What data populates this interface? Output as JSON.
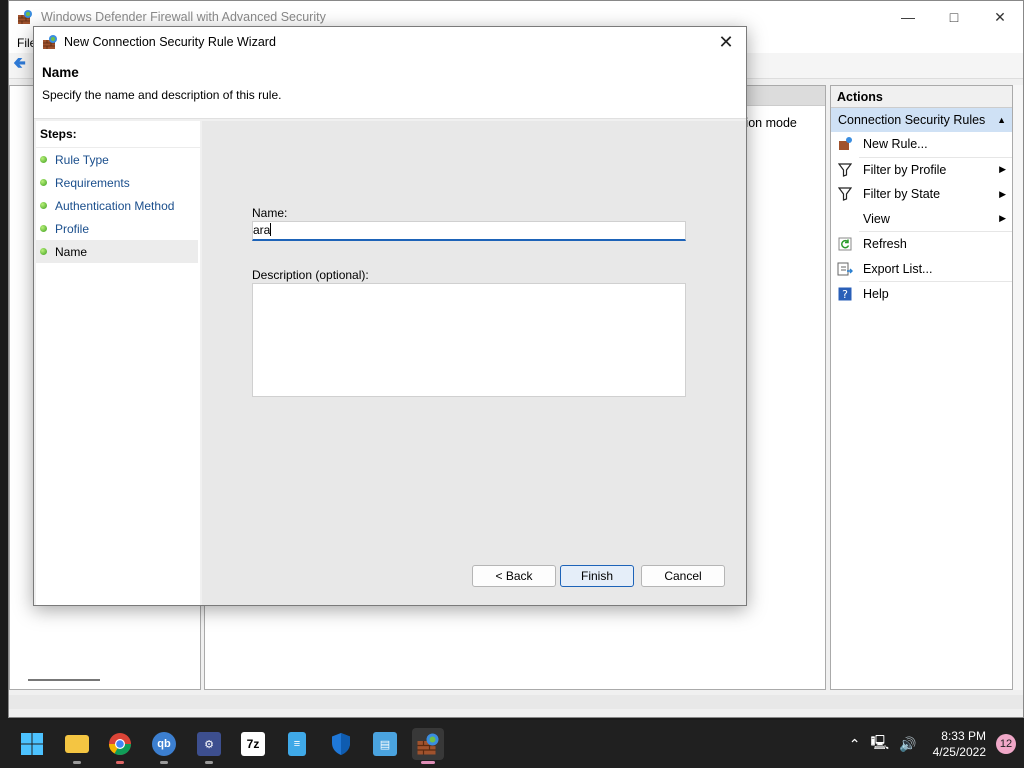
{
  "main_window": {
    "title": "Windows Defender Firewall with Advanced Security",
    "menu_first": "File",
    "center_column_text": "ation mode"
  },
  "actions": {
    "title": "Actions",
    "section": "Connection Security Rules",
    "items": [
      {
        "label": "New Rule...",
        "icon": "new-rule-icon",
        "submenu": false
      },
      {
        "label": "Filter by Profile",
        "icon": "filter-icon",
        "submenu": true
      },
      {
        "label": "Filter by State",
        "icon": "filter-icon",
        "submenu": true
      },
      {
        "label": "View",
        "icon": "",
        "submenu": true
      },
      {
        "label": "Refresh",
        "icon": "refresh-icon",
        "submenu": false
      },
      {
        "label": "Export List...",
        "icon": "export-icon",
        "submenu": false
      },
      {
        "label": "Help",
        "icon": "help-icon",
        "submenu": false
      }
    ]
  },
  "wizard": {
    "title": "New Connection Security Rule Wizard",
    "heading": "Name",
    "subheading": "Specify the name and description of this rule.",
    "steps_title": "Steps:",
    "steps": [
      "Rule Type",
      "Requirements",
      "Authentication Method",
      "Profile",
      "Name"
    ],
    "current_step": "Name",
    "name_label": "Name:",
    "name_value": "ara",
    "description_label": "Description (optional):",
    "description_value": "",
    "back_label": "< Back",
    "finish_label": "Finish",
    "cancel_label": "Cancel"
  },
  "taskbar": {
    "apps": [
      "start",
      "file-explorer",
      "chrome",
      "qbittorrent",
      "remote-app",
      "7-zip",
      "notepad",
      "windows-security",
      "network-app",
      "firewall"
    ],
    "qb_text": "qb",
    "zip_text": "7z",
    "time": "8:33 PM",
    "date": "4/25/2022",
    "notifications": "12"
  },
  "colors": {
    "accent": "#1d63b8",
    "section_bg": "#cfe1f5",
    "step_dot": "#3c9e1e",
    "taskbar_bg": "#202020"
  }
}
